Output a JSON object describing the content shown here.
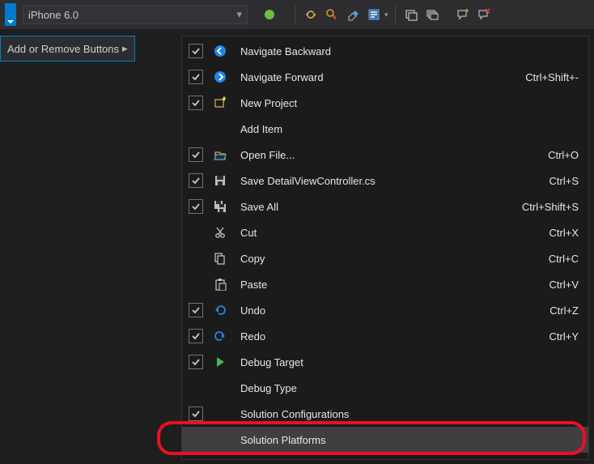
{
  "toolbar": {
    "platform_combo": "iPhone 6.0"
  },
  "add_remove_button": "Add or Remove Buttons",
  "menu": {
    "items": [
      {
        "checked": true,
        "icon": "nav-back",
        "label": "Navigate Backward",
        "shortcut": ""
      },
      {
        "checked": true,
        "icon": "nav-fwd",
        "label": "Navigate Forward",
        "shortcut": "Ctrl+Shift+-"
      },
      {
        "checked": true,
        "icon": "new-proj",
        "label": "New Project",
        "shortcut": ""
      },
      {
        "checked": false,
        "icon": "",
        "label": "Add Item",
        "shortcut": "",
        "nocheck": true
      },
      {
        "checked": true,
        "icon": "open-file",
        "label": "Open File...",
        "shortcut": "Ctrl+O"
      },
      {
        "checked": true,
        "icon": "save",
        "label": "Save DetailViewController.cs",
        "shortcut": "Ctrl+S"
      },
      {
        "checked": true,
        "icon": "save-all",
        "label": "Save All",
        "shortcut": "Ctrl+Shift+S"
      },
      {
        "checked": false,
        "icon": "cut",
        "label": "Cut",
        "shortcut": "Ctrl+X",
        "nocheck": true
      },
      {
        "checked": false,
        "icon": "copy",
        "label": "Copy",
        "shortcut": "Ctrl+C",
        "nocheck": true
      },
      {
        "checked": false,
        "icon": "paste",
        "label": "Paste",
        "shortcut": "Ctrl+V",
        "nocheck": true
      },
      {
        "checked": true,
        "icon": "undo",
        "label": "Undo",
        "shortcut": "Ctrl+Z"
      },
      {
        "checked": true,
        "icon": "redo",
        "label": "Redo",
        "shortcut": "Ctrl+Y"
      },
      {
        "checked": true,
        "icon": "play",
        "label": "Debug Target",
        "shortcut": ""
      },
      {
        "checked": false,
        "icon": "",
        "label": "Debug Type",
        "shortcut": "",
        "nocheck": true
      },
      {
        "checked": true,
        "icon": "",
        "label": "Solution Configurations",
        "shortcut": ""
      },
      {
        "checked": false,
        "icon": "",
        "label": "Solution Platforms",
        "shortcut": "",
        "hover": true,
        "nocheck": true,
        "highlight": true
      }
    ]
  }
}
